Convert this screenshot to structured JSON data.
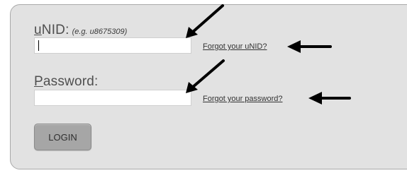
{
  "form": {
    "unid_label_initial": "u",
    "unid_label_rest": "NID:",
    "unid_hint": "(e.g. u8675309)",
    "unid_value": "",
    "forgot_unid": "Forgot your uNID?",
    "password_label_initial": "P",
    "password_label_rest": "assword:",
    "password_value": "",
    "forgot_password": "Forgot your password?",
    "login_label": "LOGIN"
  },
  "annotations": {
    "arrow_color": "#000000",
    "panel_bg": "#e2e2e2"
  }
}
